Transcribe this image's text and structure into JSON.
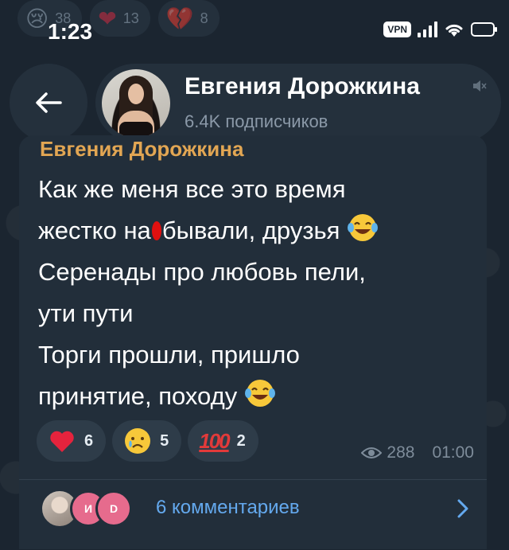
{
  "top_reactions": [
    {
      "emoji": "😢",
      "count": "38"
    },
    {
      "emoji": "❤",
      "count": "13"
    },
    {
      "emoji": "💔",
      "count": "8"
    }
  ],
  "status_bar": {
    "time": "1:23",
    "vpn": "VPN"
  },
  "header": {
    "channel_name": "Евгения Дорожкина",
    "subscribers": "6.4K подписчиков"
  },
  "message": {
    "author": "Евгения Дорожкина",
    "lines": [
      "Как же меня все это время",
      "жестко на",
      "бывали, друзья",
      "Серенады про любовь пели,",
      "ути пути",
      "Торги прошли, пришло",
      "принятие, походу"
    ],
    "reactions": [
      {
        "icon": "heart-icon",
        "count": "6"
      },
      {
        "icon": "crying-face-icon",
        "count": "5"
      },
      {
        "icon": "hundred-points-icon",
        "label": "100",
        "count": "2"
      }
    ],
    "views": "288",
    "time": "01:00"
  },
  "comments": {
    "avatar_initials": [
      "И",
      "D"
    ],
    "label": "6 комментариев"
  },
  "colors": {
    "background": "#1b2530",
    "bubble": "#222e3a",
    "author": "#e2a653",
    "link": "#64a9ee"
  }
}
